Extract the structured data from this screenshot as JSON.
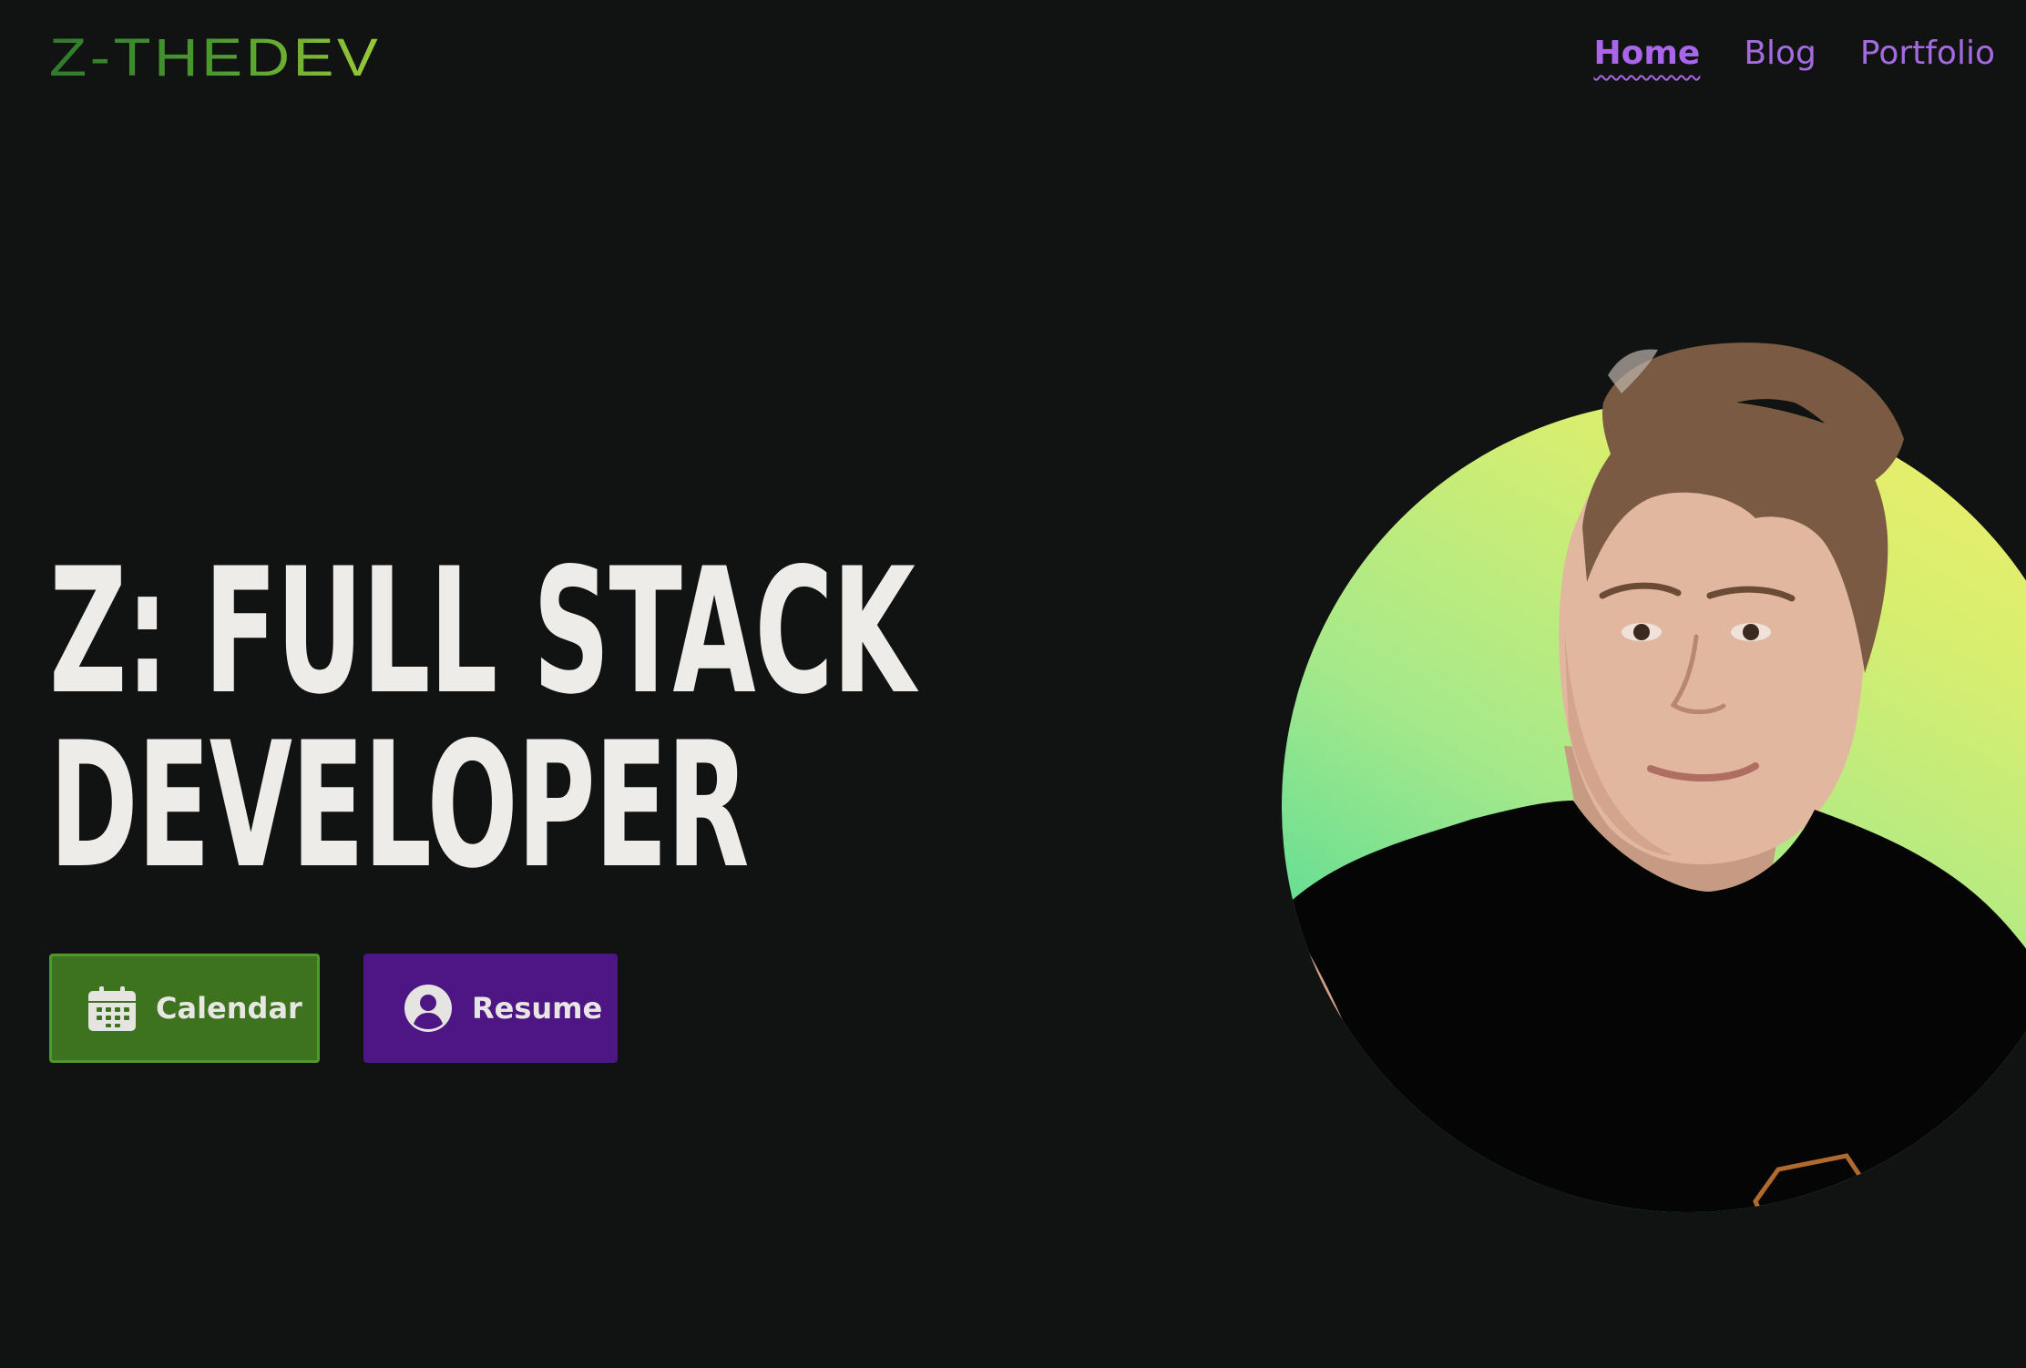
{
  "header": {
    "logo_text": "Z-THEDEV",
    "nav": [
      {
        "label": "Home",
        "active": true
      },
      {
        "label": "Blog",
        "active": false
      },
      {
        "label": "Portfolio",
        "active": false
      }
    ]
  },
  "hero": {
    "title_line1": "Z: FULL STACK",
    "title_line2": "DEVELOPER",
    "buttons": {
      "calendar": {
        "label": "Calendar",
        "icon": "calendar-icon"
      },
      "resume": {
        "label": "Resume",
        "icon": "user-circle-icon"
      }
    }
  },
  "colors": {
    "background": "#111312",
    "logo_green": "#4a9a2e",
    "nav_purple": "#a46be0",
    "title_text": "#eeece9",
    "calendar_button": "#3d731f",
    "resume_button": "#4d1684"
  }
}
